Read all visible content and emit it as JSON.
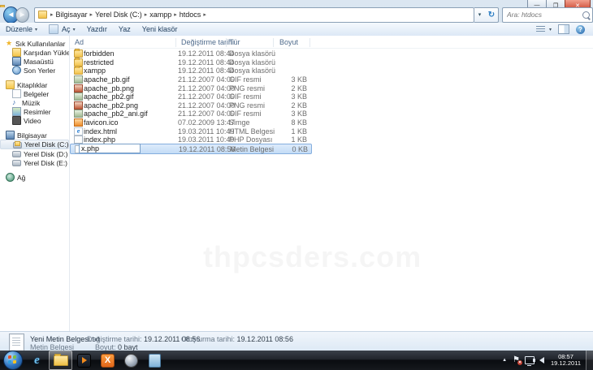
{
  "window": {
    "breadcrumb": [
      "Bilgisayar",
      "Yerel Disk (C:)",
      "xampp",
      "htdocs"
    ],
    "search_placeholder": "Ara: htdocs"
  },
  "toolbar": {
    "buttons": [
      {
        "label": "Düzenle",
        "dropdown": true,
        "icon": false
      },
      {
        "label": "Aç",
        "dropdown": true,
        "icon": true
      },
      {
        "label": "Yazdır",
        "dropdown": false,
        "icon": false
      },
      {
        "label": "Yaz",
        "dropdown": false,
        "icon": false
      },
      {
        "label": "Yeni klasör",
        "dropdown": false,
        "icon": false
      }
    ]
  },
  "sidebar": {
    "groups": [
      {
        "label": "Sık Kullanılanlar",
        "icon": "star",
        "items": [
          {
            "label": "Karşıdan Yüklemeler",
            "icon": "folder",
            "selected": false
          },
          {
            "label": "Masaüstü",
            "icon": "desktop",
            "selected": false
          },
          {
            "label": "Son Yerler",
            "icon": "recent",
            "selected": false
          }
        ]
      },
      {
        "label": "Kitaplıklar",
        "icon": "library",
        "items": [
          {
            "label": "Belgeler",
            "icon": "docs",
            "selected": false
          },
          {
            "label": "Müzik",
            "icon": "music",
            "selected": false
          },
          {
            "label": "Resimler",
            "icon": "pictures",
            "selected": false
          },
          {
            "label": "Video",
            "icon": "video",
            "selected": false
          }
        ]
      },
      {
        "label": "Bilgisayar",
        "icon": "computer",
        "items": [
          {
            "label": "Yerel Disk (C:)",
            "icon": "disk-c",
            "selected": true
          },
          {
            "label": "Yerel Disk (D:)",
            "icon": "disk",
            "selected": false
          },
          {
            "label": "Yerel Disk (E:)",
            "icon": "disk",
            "selected": false
          }
        ]
      },
      {
        "label": "Ağ",
        "icon": "network",
        "items": []
      }
    ]
  },
  "filelist": {
    "columns": [
      "Ad",
      "Değiştirme tarihi",
      "Tür",
      "Boyut"
    ],
    "rows": [
      {
        "name": "forbidden",
        "date": "19.12.2011 08:44",
        "type": "Dosya klasörü",
        "size": "",
        "icon": "folder",
        "renaming": false
      },
      {
        "name": "restricted",
        "date": "19.12.2011 08:44",
        "type": "Dosya klasörü",
        "size": "",
        "icon": "folder",
        "renaming": false
      },
      {
        "name": "xampp",
        "date": "19.12.2011 08:44",
        "type": "Dosya klasörü",
        "size": "",
        "icon": "folder",
        "renaming": false
      },
      {
        "name": "apache_pb.gif",
        "date": "21.12.2007 04:00",
        "type": "GIF resmi",
        "size": "3 KB",
        "icon": "image-gif",
        "renaming": false
      },
      {
        "name": "apache_pb.png",
        "date": "21.12.2007 04:00",
        "type": "PNG resmi",
        "size": "2 KB",
        "icon": "image-png",
        "renaming": false
      },
      {
        "name": "apache_pb2.gif",
        "date": "21.12.2007 04:00",
        "type": "GIF resmi",
        "size": "3 KB",
        "icon": "image-gif",
        "renaming": false
      },
      {
        "name": "apache_pb2.png",
        "date": "21.12.2007 04:00",
        "type": "PNG resmi",
        "size": "2 KB",
        "icon": "image-png",
        "renaming": false
      },
      {
        "name": "apache_pb2_ani.gif",
        "date": "21.12.2007 04:00",
        "type": "GIF resmi",
        "size": "3 KB",
        "icon": "image-gif",
        "renaming": false
      },
      {
        "name": "favicon.ico",
        "date": "07.02.2009 13:47",
        "type": "Simge",
        "size": "8 KB",
        "icon": "ico",
        "renaming": false
      },
      {
        "name": "index.html",
        "date": "19.03.2011 10:49",
        "type": "HTML Belgesi",
        "size": "1 KB",
        "icon": "html",
        "renaming": false
      },
      {
        "name": "index.php",
        "date": "19.03.2011 10:49",
        "type": "PHP Dosyası",
        "size": "1 KB",
        "icon": "file",
        "renaming": false
      },
      {
        "name": "x.php",
        "date": "19.12.2011 08:56",
        "type": "Metin Belgesi",
        "size": "0 KB",
        "icon": "file",
        "renaming": true
      }
    ]
  },
  "details": {
    "filename": "Yeni Metin Belgesi.txt",
    "filetype": "Metin Belgesi",
    "modified_label": "Değiştirme tarihi:",
    "modified_value": "19.12.2011 08:56",
    "size_label": "Boyut:",
    "size_value": "0 bayt",
    "created_label": "Oluşturma tarihi:",
    "created_value": "19.12.2011 08:56"
  },
  "taskbar": {
    "clock_time": "08:57",
    "clock_date": "19.12.2011"
  },
  "watermark": "thpcsders.com"
}
